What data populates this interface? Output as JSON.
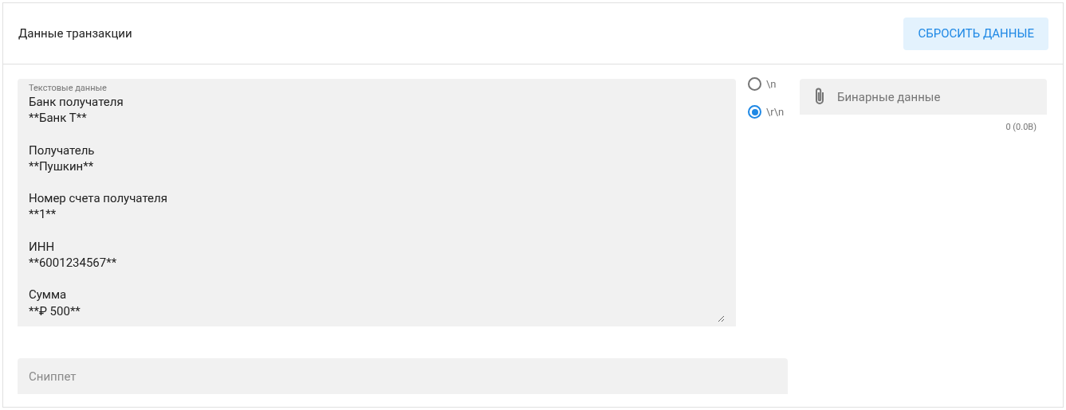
{
  "header": {
    "title": "Данные транзакции",
    "reset_button": "СБРОСИТЬ ДАННЫЕ"
  },
  "text_data": {
    "label": "Текстовые данные",
    "value": "Банк получателя\n**Банк Т**\n\nПолучатель\n**Пушкин**\n\nНомер счета получателя\n**1**\n\nИНН\n**6001234567**\n\nСумма\n**₽ 500**"
  },
  "line_endings": [
    {
      "label": "\\n",
      "selected": false
    },
    {
      "label": "\\r\\n",
      "selected": true
    }
  ],
  "binary_data": {
    "placeholder": "Бинарные данные",
    "size": "0 (0.0B)"
  },
  "snippet": {
    "placeholder": "Сниппет"
  }
}
